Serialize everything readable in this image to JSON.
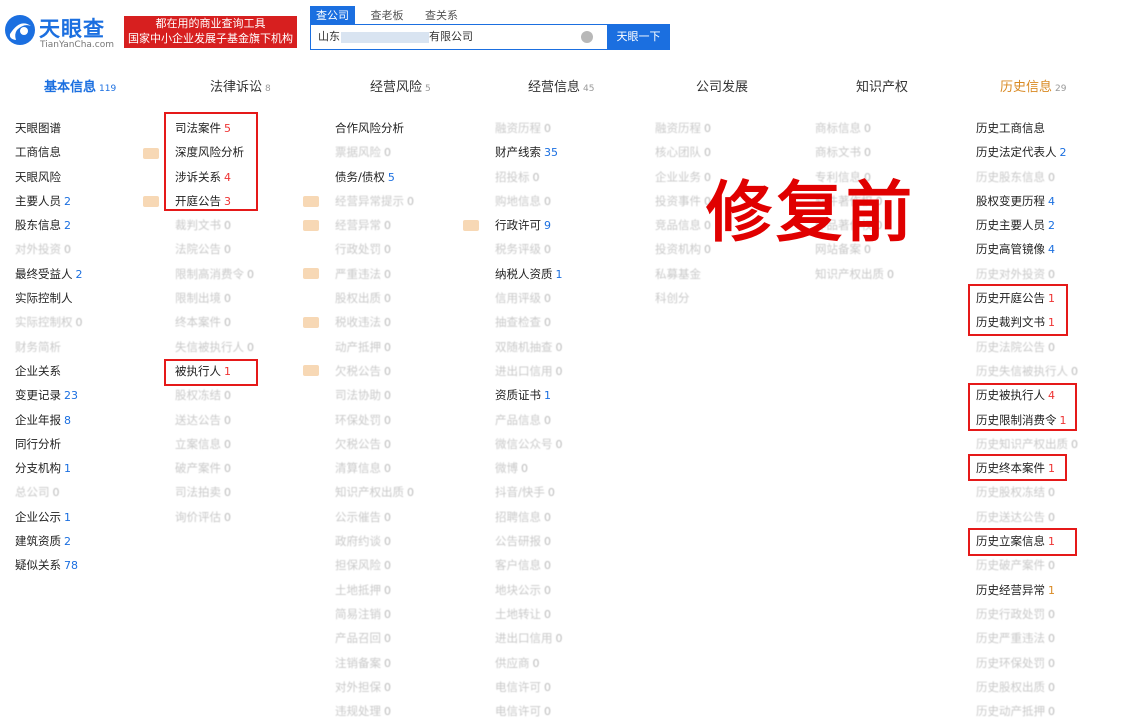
{
  "logo": {
    "name": "天眼查",
    "url": "TianYanCha.com"
  },
  "slogan": [
    "都在用的商业查询工具",
    "国家中小企业发展子基金旗下机构"
  ],
  "search_tabs": [
    {
      "label": "查公司",
      "active": true
    },
    {
      "label": "查老板",
      "active": false
    },
    {
      "label": "查关系",
      "active": false
    }
  ],
  "search": {
    "prefix": "山东",
    "suffix": "有限公司",
    "button": "天眼一下"
  },
  "nav": [
    {
      "label": "基本信息",
      "count": "119",
      "state": "active"
    },
    {
      "label": "法律诉讼",
      "count": "8",
      "state": "normal"
    },
    {
      "label": "经营风险",
      "count": "5",
      "state": "normal"
    },
    {
      "label": "经营信息",
      "count": "45",
      "state": "normal"
    },
    {
      "label": "公司发展",
      "count": "",
      "state": "normal"
    },
    {
      "label": "知识产权",
      "count": "",
      "state": "normal"
    },
    {
      "label": "历史信息",
      "count": "29",
      "state": "history"
    }
  ],
  "watermark": "修复前",
  "colors": {
    "brand_blue": "#1b6fe0",
    "highlight_red": "#e51919",
    "faded": "#c9c9c9"
  },
  "columns": [
    {
      "items": [
        {
          "label": "天眼图谱",
          "count": "",
          "active": true,
          "color": ""
        },
        {
          "label": "工商信息",
          "count": "",
          "active": true,
          "color": ""
        },
        {
          "label": "天眼风险",
          "count": "",
          "active": true,
          "color": ""
        },
        {
          "label": "主要人员",
          "count": "2",
          "active": true,
          "color": "blue"
        },
        {
          "label": "股东信息",
          "count": "2",
          "active": true,
          "color": "blue"
        },
        {
          "label": "对外投资",
          "count": "0",
          "active": false,
          "color": "grey"
        },
        {
          "label": "最终受益人",
          "count": "2",
          "active": true,
          "color": "blue"
        },
        {
          "label": "实际控制人",
          "count": "",
          "active": true,
          "color": ""
        },
        {
          "label": "实际控制权",
          "count": "0",
          "active": false,
          "color": "grey"
        },
        {
          "label": "财务简析",
          "count": "",
          "active": false,
          "color": ""
        },
        {
          "label": "企业关系",
          "count": "",
          "active": true,
          "color": ""
        },
        {
          "label": "变更记录",
          "count": "23",
          "active": true,
          "color": "blue"
        },
        {
          "label": "企业年报",
          "count": "8",
          "active": true,
          "color": "blue"
        },
        {
          "label": "同行分析",
          "count": "",
          "active": true,
          "color": ""
        },
        {
          "label": "分支机构",
          "count": "1",
          "active": true,
          "color": "blue"
        },
        {
          "label": "总公司",
          "count": "0",
          "active": false,
          "color": "grey"
        },
        {
          "label": "企业公示",
          "count": "1",
          "active": true,
          "color": "blue"
        },
        {
          "label": "建筑资质",
          "count": "2",
          "active": true,
          "color": "blue"
        },
        {
          "label": "疑似关系",
          "count": "78",
          "active": true,
          "color": "blue"
        }
      ]
    },
    {
      "items": [
        {
          "label": "司法案件",
          "count": "5",
          "active": true,
          "color": "red"
        },
        {
          "label": "深度风险分析",
          "count": "",
          "active": true,
          "color": ""
        },
        {
          "label": "涉诉关系",
          "count": "4",
          "active": true,
          "color": "red"
        },
        {
          "label": "开庭公告",
          "count": "3",
          "active": true,
          "color": "red"
        },
        {
          "label": "裁判文书",
          "count": "0",
          "active": false,
          "color": "grey"
        },
        {
          "label": "法院公告",
          "count": "0",
          "active": false,
          "color": "grey"
        },
        {
          "label": "限制高消费令",
          "count": "0",
          "active": false,
          "color": "grey"
        },
        {
          "label": "限制出境",
          "count": "0",
          "active": false,
          "color": "grey"
        },
        {
          "label": "终本案件",
          "count": "0",
          "active": false,
          "color": "grey"
        },
        {
          "label": "失信被执行人",
          "count": "0",
          "active": false,
          "color": "grey"
        },
        {
          "label": "被执行人",
          "count": "1",
          "active": true,
          "color": "red"
        },
        {
          "label": "股权冻结",
          "count": "0",
          "active": false,
          "color": "grey"
        },
        {
          "label": "送达公告",
          "count": "0",
          "active": false,
          "color": "grey"
        },
        {
          "label": "立案信息",
          "count": "0",
          "active": false,
          "color": "grey"
        },
        {
          "label": "破产案件",
          "count": "0",
          "active": false,
          "color": "grey"
        },
        {
          "label": "司法拍卖",
          "count": "0",
          "active": false,
          "color": "grey"
        },
        {
          "label": "询价评估",
          "count": "0",
          "active": false,
          "color": "grey"
        }
      ]
    },
    {
      "items": [
        {
          "label": "合作风险分析",
          "count": "",
          "active": true,
          "color": ""
        },
        {
          "label": "票据风险",
          "count": "0",
          "active": false,
          "color": "grey"
        },
        {
          "label": "债务/债权",
          "count": "5",
          "active": true,
          "color": "blue"
        },
        {
          "label": "经营异常提示",
          "count": "0",
          "active": false,
          "color": "grey"
        },
        {
          "label": "经营异常",
          "count": "0",
          "active": false,
          "color": "grey"
        },
        {
          "label": "行政处罚",
          "count": "0",
          "active": false,
          "color": "grey"
        },
        {
          "label": "严重违法",
          "count": "0",
          "active": false,
          "color": "grey"
        },
        {
          "label": "股权出质",
          "count": "0",
          "active": false,
          "color": "grey"
        },
        {
          "label": "税收违法",
          "count": "0",
          "active": false,
          "color": "grey"
        },
        {
          "label": "动产抵押",
          "count": "0",
          "active": false,
          "color": "grey"
        },
        {
          "label": "欠税公告",
          "count": "0",
          "active": false,
          "color": "grey"
        },
        {
          "label": "司法协助",
          "count": "0",
          "active": false,
          "color": "grey"
        },
        {
          "label": "环保处罚",
          "count": "0",
          "active": false,
          "color": "grey"
        },
        {
          "label": "欠税公告",
          "count": "0",
          "active": false,
          "color": "grey"
        },
        {
          "label": "清算信息",
          "count": "0",
          "active": false,
          "color": "grey"
        },
        {
          "label": "知识产权出质",
          "count": "0",
          "active": false,
          "color": "grey"
        },
        {
          "label": "公示催告",
          "count": "0",
          "active": false,
          "color": "grey"
        },
        {
          "label": "政府约谈",
          "count": "0",
          "active": false,
          "color": "grey"
        },
        {
          "label": "担保风险",
          "count": "0",
          "active": false,
          "color": "grey"
        },
        {
          "label": "土地抵押",
          "count": "0",
          "active": false,
          "color": "grey"
        },
        {
          "label": "简易注销",
          "count": "0",
          "active": false,
          "color": "grey"
        },
        {
          "label": "产品召回",
          "count": "0",
          "active": false,
          "color": "grey"
        },
        {
          "label": "注销备案",
          "count": "0",
          "active": false,
          "color": "grey"
        },
        {
          "label": "对外担保",
          "count": "0",
          "active": false,
          "color": "grey"
        },
        {
          "label": "违规处理",
          "count": "0",
          "active": false,
          "color": "grey"
        }
      ]
    },
    {
      "items": [
        {
          "label": "融资历程",
          "count": "0",
          "active": false,
          "color": "grey"
        },
        {
          "label": "财产线索",
          "count": "35",
          "active": true,
          "color": "blue"
        },
        {
          "label": "招投标",
          "count": "0",
          "active": false,
          "color": "grey"
        },
        {
          "label": "购地信息",
          "count": "0",
          "active": false,
          "color": "grey"
        },
        {
          "label": "行政许可",
          "count": "9",
          "active": true,
          "color": "blue"
        },
        {
          "label": "税务评级",
          "count": "0",
          "active": false,
          "color": "grey"
        },
        {
          "label": "纳税人资质",
          "count": "1",
          "active": true,
          "color": "blue"
        },
        {
          "label": "信用评级",
          "count": "0",
          "active": false,
          "color": "grey"
        },
        {
          "label": "抽查检查",
          "count": "0",
          "active": false,
          "color": "grey"
        },
        {
          "label": "双随机抽查",
          "count": "0",
          "active": false,
          "color": "grey"
        },
        {
          "label": "进出口信用",
          "count": "0",
          "active": false,
          "color": "grey"
        },
        {
          "label": "资质证书",
          "count": "1",
          "active": true,
          "color": "blue"
        },
        {
          "label": "产品信息",
          "count": "0",
          "active": false,
          "color": "grey"
        },
        {
          "label": "微信公众号",
          "count": "0",
          "active": false,
          "color": "grey"
        },
        {
          "label": "微博",
          "count": "0",
          "active": false,
          "color": "grey"
        },
        {
          "label": "抖音/快手",
          "count": "0",
          "active": false,
          "color": "grey"
        },
        {
          "label": "招聘信息",
          "count": "0",
          "active": false,
          "color": "grey"
        },
        {
          "label": "公告研报",
          "count": "0",
          "active": false,
          "color": "grey"
        },
        {
          "label": "客户信息",
          "count": "0",
          "active": false,
          "color": "grey"
        },
        {
          "label": "地块公示",
          "count": "0",
          "active": false,
          "color": "grey"
        },
        {
          "label": "土地转让",
          "count": "0",
          "active": false,
          "color": "grey"
        },
        {
          "label": "进出口信用",
          "count": "0",
          "active": false,
          "color": "grey"
        },
        {
          "label": "供应商",
          "count": "0",
          "active": false,
          "color": "grey"
        },
        {
          "label": "电信许可",
          "count": "0",
          "active": false,
          "color": "grey"
        },
        {
          "label": "电信许可",
          "count": "0",
          "active": false,
          "color": "grey"
        }
      ]
    },
    {
      "items": [
        {
          "label": "融资历程",
          "count": "0",
          "active": false,
          "color": "grey"
        },
        {
          "label": "核心团队",
          "count": "0",
          "active": false,
          "color": "grey"
        },
        {
          "label": "企业业务",
          "count": "0",
          "active": false,
          "color": "grey"
        },
        {
          "label": "投资事件",
          "count": "0",
          "active": false,
          "color": "grey"
        },
        {
          "label": "竞品信息",
          "count": "0",
          "active": false,
          "color": "grey"
        },
        {
          "label": "投资机构",
          "count": "0",
          "active": false,
          "color": "grey"
        },
        {
          "label": "私募基金",
          "count": "",
          "active": false,
          "color": ""
        },
        {
          "label": "科创分",
          "count": "",
          "active": false,
          "color": ""
        }
      ]
    },
    {
      "items": [
        {
          "label": "商标信息",
          "count": "0",
          "active": false,
          "color": "grey"
        },
        {
          "label": "商标文书",
          "count": "0",
          "active": false,
          "color": "grey"
        },
        {
          "label": "专利信息",
          "count": "0",
          "active": false,
          "color": "grey"
        },
        {
          "label": "软件著作权",
          "count": "0",
          "active": false,
          "color": "grey"
        },
        {
          "label": "作品著作权",
          "count": "0",
          "active": false,
          "color": "grey"
        },
        {
          "label": "网站备案",
          "count": "0",
          "active": false,
          "color": "grey"
        },
        {
          "label": "知识产权出质",
          "count": "0",
          "active": false,
          "color": "grey"
        }
      ]
    },
    {
      "items": [
        {
          "label": "历史工商信息",
          "count": "",
          "active": true,
          "color": ""
        },
        {
          "label": "历史法定代表人",
          "count": "2",
          "active": true,
          "color": "blue"
        },
        {
          "label": "历史股东信息",
          "count": "0",
          "active": false,
          "color": "grey"
        },
        {
          "label": "股权变更历程",
          "count": "4",
          "active": true,
          "color": "blue"
        },
        {
          "label": "历史主要人员",
          "count": "2",
          "active": true,
          "color": "blue"
        },
        {
          "label": "历史高管镜像",
          "count": "4",
          "active": true,
          "color": "blue"
        },
        {
          "label": "历史对外投资",
          "count": "0",
          "active": false,
          "color": "grey"
        },
        {
          "label": "历史开庭公告",
          "count": "1",
          "active": true,
          "color": "red"
        },
        {
          "label": "历史裁判文书",
          "count": "1",
          "active": true,
          "color": "red"
        },
        {
          "label": "历史法院公告",
          "count": "0",
          "active": false,
          "color": "grey"
        },
        {
          "label": "历史失信被执行人",
          "count": "0",
          "active": false,
          "color": "grey"
        },
        {
          "label": "历史被执行人",
          "count": "4",
          "active": true,
          "color": "red"
        },
        {
          "label": "历史限制消费令",
          "count": "1",
          "active": true,
          "color": "red"
        },
        {
          "label": "历史知识产权出质",
          "count": "0",
          "active": false,
          "color": "grey"
        },
        {
          "label": "历史终本案件",
          "count": "1",
          "active": true,
          "color": "red"
        },
        {
          "label": "历史股权冻结",
          "count": "0",
          "active": false,
          "color": "grey"
        },
        {
          "label": "历史送达公告",
          "count": "0",
          "active": false,
          "color": "grey"
        },
        {
          "label": "历史立案信息",
          "count": "1",
          "active": true,
          "color": "red"
        },
        {
          "label": "历史破产案件",
          "count": "0",
          "active": false,
          "color": "grey"
        },
        {
          "label": "历史经营异常",
          "count": "1",
          "active": true,
          "color": "orange"
        },
        {
          "label": "历史行政处罚",
          "count": "0",
          "active": false,
          "color": "grey"
        },
        {
          "label": "历史严重违法",
          "count": "0",
          "active": false,
          "color": "grey"
        },
        {
          "label": "历史环保处罚",
          "count": "0",
          "active": false,
          "color": "grey"
        },
        {
          "label": "历史股权出质",
          "count": "0",
          "active": false,
          "color": "grey"
        },
        {
          "label": "历史动产抵押",
          "count": "0",
          "active": false,
          "color": "grey"
        }
      ]
    }
  ]
}
